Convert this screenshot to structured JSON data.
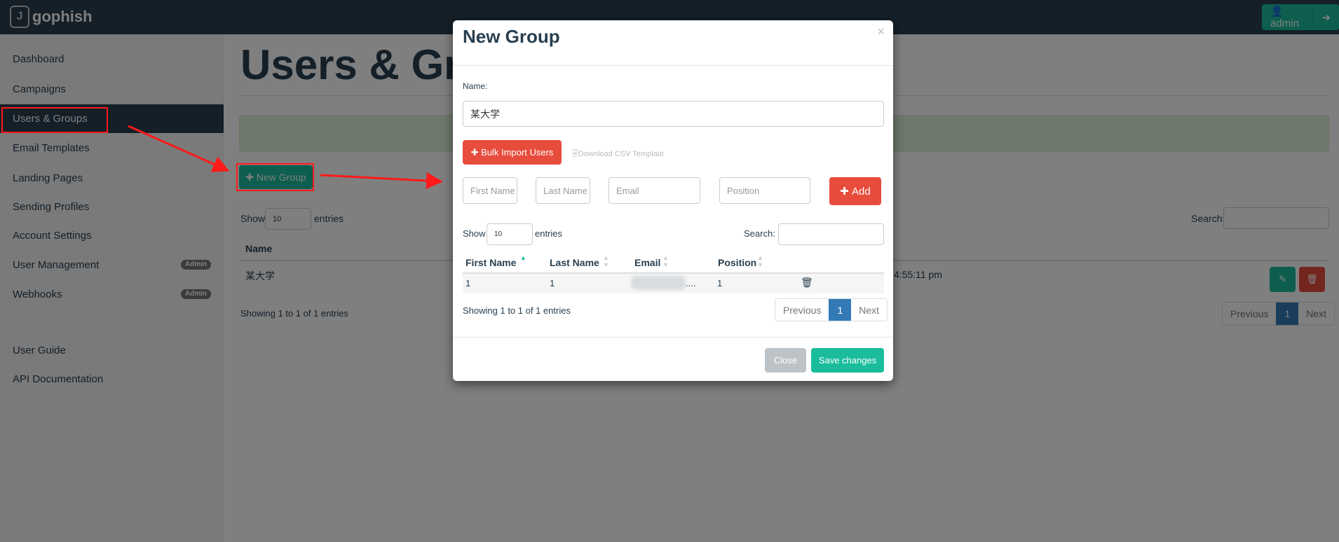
{
  "app": {
    "brand": "gophish",
    "user_label": "admin",
    "logout_icon": "sign-out-icon"
  },
  "sidebar": {
    "items": [
      {
        "label": "Dashboard"
      },
      {
        "label": "Campaigns"
      },
      {
        "label": "Users & Groups",
        "active": true
      },
      {
        "label": "Email Templates"
      },
      {
        "label": "Landing Pages"
      },
      {
        "label": "Sending Profiles"
      },
      {
        "label": "Account Settings"
      },
      {
        "label": "User Management",
        "badge": "Admin"
      },
      {
        "label": "Webhooks",
        "badge": "Admin"
      },
      {
        "label": "User Guide"
      },
      {
        "label": "API Documentation"
      }
    ]
  },
  "page": {
    "title": "Users & Grou",
    "new_group_label": "New Group",
    "show_label": "Show",
    "entries_value": "10",
    "entries_label": "entries",
    "search_label": "Search:",
    "name_header": "Name",
    "row_name": "某大学",
    "row_time": "4:55:11 pm",
    "showing": "Showing 1 to 1 of 1 entries",
    "previous": "Previous",
    "page": "1",
    "next": "Next"
  },
  "modal": {
    "title": "New Group",
    "close_x": "×",
    "name_label": "Name:",
    "name_value": "某大学",
    "bulk_import_label": "Bulk Import Users",
    "download_csv_label": "Download CSV Template",
    "placeholders": {
      "first": "First Name",
      "last": "Last Name",
      "email": "Email",
      "position": "Position"
    },
    "add_label": "Add",
    "show_label": "Show",
    "entries_value": "10",
    "entries_label": "entries",
    "search_label": "Search:",
    "columns": [
      "First Name",
      "Last Name",
      "Email",
      "Position"
    ],
    "rows": [
      {
        "first": "1",
        "last": "1",
        "email": "....",
        "position": "1"
      }
    ],
    "showing": "Showing 1 to 1 of 1 entries",
    "previous": "Previous",
    "page": "1",
    "next": "Next",
    "close_label": "Close",
    "save_label": "Save changes"
  },
  "colors": {
    "navbar": "#283f50",
    "primary": "#1abc9c",
    "danger": "#e74c3c",
    "annotation": "#ff1a1a"
  }
}
